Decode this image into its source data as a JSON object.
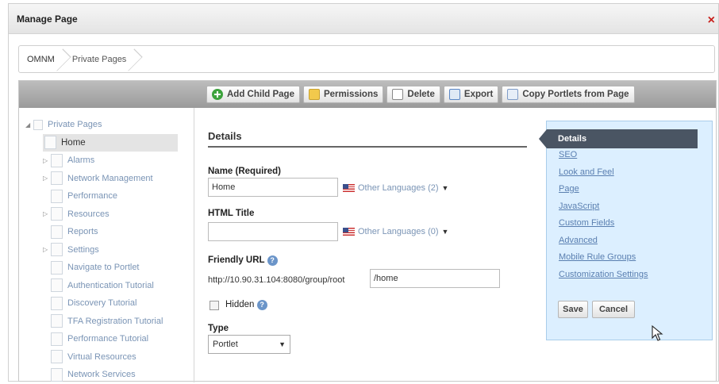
{
  "dialog": {
    "title": "Manage Page",
    "close_label": "×"
  },
  "breadcrumb": {
    "root": "OMNM",
    "current": "Private Pages"
  },
  "toolbar": {
    "add_child": "Add Child Page",
    "permissions": "Permissions",
    "delete": "Delete",
    "export": "Export",
    "copy_portlets": "Copy Portlets from Page"
  },
  "tree": {
    "root": "Private Pages",
    "items": [
      {
        "label": "Home"
      },
      {
        "label": "Alarms"
      },
      {
        "label": "Network Management"
      },
      {
        "label": "Performance"
      },
      {
        "label": "Resources"
      },
      {
        "label": "Reports"
      },
      {
        "label": "Settings"
      },
      {
        "label": "Navigate to Portlet"
      },
      {
        "label": "Authentication Tutorial"
      },
      {
        "label": "Discovery Tutorial"
      },
      {
        "label": "TFA Registration Tutorial"
      },
      {
        "label": "Performance Tutorial"
      },
      {
        "label": "Virtual Resources"
      },
      {
        "label": "Network Services"
      }
    ]
  },
  "details": {
    "heading": "Details",
    "name_label": "Name (Required)",
    "name_value": "Home",
    "name_languages": "Other Languages (2)",
    "html_title_label": "HTML Title",
    "html_title_value": "",
    "html_title_languages": "Other Languages (0)",
    "friendly_url_label": "Friendly URL",
    "friendly_url_prefix": "http://10.90.31.104:8080/group/root",
    "friendly_url_value": "/home",
    "hidden_label": "Hidden",
    "hidden_checked": false,
    "type_label": "Type",
    "type_value": "Portlet"
  },
  "nav": {
    "active": "Details",
    "links": [
      "SEO",
      "Look and Feel",
      "Page",
      "JavaScript",
      "Custom Fields",
      "Advanced",
      "Mobile Rule Groups",
      "Customization Settings"
    ],
    "save": "Save",
    "cancel": "Cancel"
  },
  "colors": {
    "nav_bg": "#dcefff",
    "active_tab": "#4a5563",
    "link": "#5a7fb0",
    "close": "#c8201c"
  }
}
